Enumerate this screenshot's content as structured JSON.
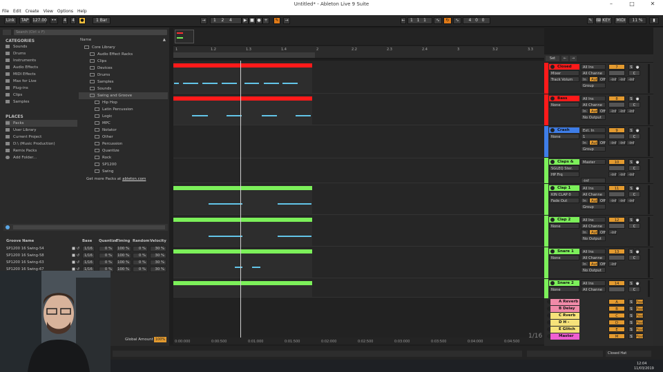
{
  "window": {
    "title": "Untitled* - Ableton Live 9 Suite"
  },
  "menu": [
    "File",
    "Edit",
    "Create",
    "View",
    "Options",
    "Help"
  ],
  "transport": {
    "link": "Link",
    "tap": "TAP",
    "tempo": "127.00",
    "sig_num": "4",
    "sig_den": "4",
    "quant": "1 Bar",
    "pos1": "1",
    "pos2": "2",
    "pos3": "4",
    "loop_pos": "1",
    "loop_beat": "1",
    "loop_sixteenth": "1",
    "key": "KEY",
    "midi": "MIDI",
    "cpu": "11 %"
  },
  "browser": {
    "search_placeholder": "Search (Ctrl + F)",
    "categories_header": "CATEGORIES",
    "categories": [
      "Sounds",
      "Drums",
      "Instruments",
      "Audio Effects",
      "MIDI Effects",
      "Max for Live",
      "Plug-ins",
      "Clips",
      "Samples"
    ],
    "places_header": "PLACES",
    "places": [
      "Packs",
      "User Library",
      "Current Project",
      "D:\\ (Music Production)",
      "Remix Packs",
      "Add Folder..."
    ],
    "name_header": "Name",
    "tree": [
      "Core Library",
      "Audio Effect Racks",
      "Clips",
      "Devices",
      "Drums",
      "Samples",
      "Sounds",
      "Swing and Groove",
      "Hip Hop",
      "Latin Percussion",
      "Logic",
      "MPC",
      "Notator",
      "Other",
      "Percussion",
      "Quantize",
      "Rock",
      "SP1200",
      "Swing"
    ],
    "more_packs": "Get more Packs at",
    "more_packs_link": "ableton.com"
  },
  "grooves": {
    "headers": [
      "Groove Name",
      "Base",
      "Quantize",
      "Timing",
      "Random",
      "Velocity"
    ],
    "rows": [
      {
        "name": "SP1200 16 Swing-54",
        "base": "1/16",
        "quantize": "0 %",
        "timing": "100 %",
        "random": "0 %",
        "velocity": "30 %"
      },
      {
        "name": "SP1200 16 Swing-58",
        "base": "1/16",
        "quantize": "0 %",
        "timing": "100 %",
        "random": "0 %",
        "velocity": "30 %"
      },
      {
        "name": "SP1200 16 Swing-63",
        "base": "1/16",
        "quantize": "0 %",
        "timing": "100 %",
        "random": "0 %",
        "velocity": "30 %"
      },
      {
        "name": "SP1200 16 Swing-67",
        "base": "1/16",
        "quantize": "0 %",
        "timing": "100 %",
        "random": "0 %",
        "velocity": "30 %"
      }
    ],
    "global_amount_label": "Global Amount",
    "global_amount": "100%"
  },
  "ruler": [
    "1",
    "1.2",
    "1.3",
    "1.4",
    "2",
    "2.2",
    "2.3",
    "2.4",
    "3",
    "3.2",
    "3.3"
  ],
  "timebar": [
    "0:00:000",
    "0:00:500",
    "0:01:000",
    "0:01:500",
    "0:02:000",
    "0:02:500",
    "0:03:000",
    "0:03:500",
    "0:04:000",
    "0:04:500"
  ],
  "grid_readout": "1/16",
  "mixer": {
    "set_label": "Set",
    "tracks": [
      {
        "name": "Closed Hat",
        "color": "#ff1a1a",
        "input": "All Ins",
        "sub": "Mixer",
        "sub2": "Track Volum",
        "num": "7",
        "in": "In",
        "auto": "Auto",
        "off": "Off",
        "group": "Group",
        "chan": "All Channe",
        "v1": "-inf",
        "v2": "-inf",
        "v3": "-inf",
        "s": "S",
        "c": "C"
      },
      {
        "name": "Bass",
        "color": "#ff1a1a",
        "input": "All Ins",
        "sub": "None",
        "sub2": "",
        "num": "8",
        "in": "In",
        "auto": "Auto",
        "off": "Off",
        "group": "No Output",
        "chan": "All Channe",
        "v1": "-inf",
        "v2": "-inf",
        "v3": "-inf",
        "s": "S",
        "c": "C"
      },
      {
        "name": "Crash",
        "color": "#3e7de8",
        "input": "Ext. In",
        "sub": "None",
        "sub2": "",
        "num": "9",
        "in": "In",
        "auto": "Auto",
        "off": "Off",
        "group": "Group",
        "chan": "1",
        "v1": "-inf",
        "v2": "-inf",
        "v3": "-inf",
        "s": "S",
        "c": "C"
      },
      {
        "name": "Claps & Snare",
        "color": "#7cf05a",
        "input": "Master",
        "sub": "SGLEQ Ster.",
        "sub2": "HP Frq",
        "num": "10",
        "in": "",
        "auto": "",
        "off": "",
        "group": "-inf",
        "chan": "",
        "v1": "-inf",
        "v2": "-inf",
        "v3": "-inf",
        "s": "S",
        "c": "C"
      },
      {
        "name": "Clap 1",
        "color": "#7cf05a",
        "input": "All Ins",
        "sub": "KIN CLAP 0",
        "sub2": "Fade Out",
        "num": "11",
        "in": "In",
        "auto": "Auto",
        "off": "Off",
        "group": "Group",
        "chan": "All Channe",
        "v1": "-inf",
        "v2": "-inf",
        "v3": "-inf",
        "s": "S",
        "c": "C"
      },
      {
        "name": "Clap 2",
        "color": "#7cf05a",
        "input": "All Ins",
        "sub": "None",
        "sub2": "",
        "num": "12",
        "in": "In",
        "auto": "Auto",
        "off": "Off",
        "group": "No Output",
        "chan": "All Channe",
        "v1": "-inf",
        "v2": "",
        "v3": "",
        "s": "S",
        "c": "C"
      },
      {
        "name": "Snare 1",
        "color": "#7cf05a",
        "input": "All Ins",
        "sub": "None",
        "sub2": "",
        "num": "13",
        "in": "In",
        "auto": "Auto",
        "off": "Off",
        "group": "No Output",
        "chan": "All Channe",
        "v1": "-inf",
        "v2": "",
        "v3": "",
        "s": "S",
        "c": "C"
      },
      {
        "name": "Snare 2",
        "color": "#7cf05a",
        "input": "All Ins",
        "sub": "None",
        "sub2": "",
        "num": "14",
        "in": "",
        "auto": "",
        "off": "",
        "group": "",
        "chan": "All Channe",
        "v1": "",
        "v2": "",
        "v3": "",
        "s": "S",
        "c": "C"
      }
    ],
    "returns": [
      {
        "name": "A Reverb",
        "color": "#f08aa8",
        "letter": "A"
      },
      {
        "name": "B Delay",
        "color": "#f08aa8",
        "letter": "B"
      },
      {
        "name": "C Rverb",
        "color": "#f6e27a",
        "letter": "C"
      },
      {
        "name": "D H - Delay",
        "color": "#f6e27a",
        "letter": "D"
      },
      {
        "name": "E Glitch",
        "color": "#f6e27a",
        "letter": "E"
      },
      {
        "name": "Master",
        "color": "#ef5fd1",
        "letter": "M"
      }
    ],
    "post_label": "Post",
    "master_half": "1/2",
    "master_num": "0"
  },
  "status": {
    "right_label": "Closed Hat",
    "time": "12:04",
    "date": "11/03/2019"
  },
  "colors": {
    "red_clip": "#ff1a1a",
    "green_clip": "#7cf05a",
    "note": "#63c6ea",
    "accent": "#e07a18"
  }
}
